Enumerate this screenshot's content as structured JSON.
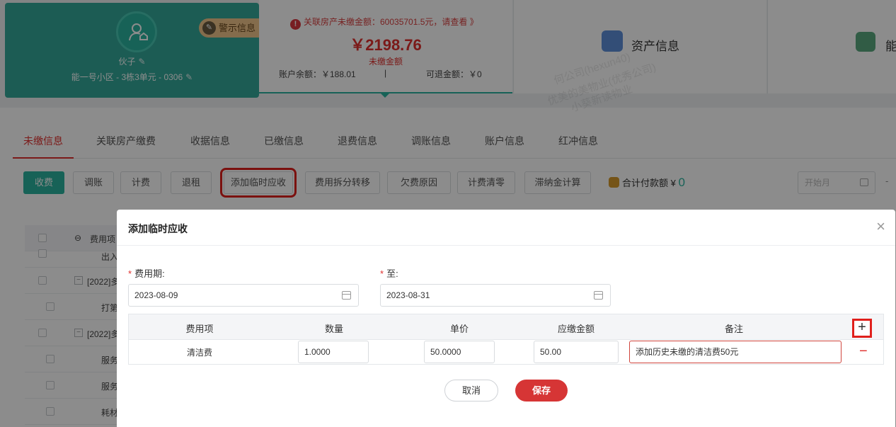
{
  "owner": {
    "name": "伙子",
    "house": "能一号小区 - 3栋3单元 - 0306",
    "warning_label": "警示信息"
  },
  "arrears": {
    "alert": "关联房产未缴金额：60035701.5元，请查看 》",
    "amount": "￥2198.76",
    "amount_label": "未缴金额",
    "balance": "账户余额：￥188.01",
    "separator": "|",
    "refundable": "可退金额：￥0"
  },
  "panels": {
    "asset_label": "资产信息",
    "energy_label": "能"
  },
  "watermarks": [
    "何公司(hexun40)",
    "优美的美物业(优秀公司)",
    "小葵新读物业"
  ],
  "tabs": [
    {
      "label": "未缴信息"
    },
    {
      "label": "关联房产缴费"
    },
    {
      "label": "收据信息"
    },
    {
      "label": "已缴信息"
    },
    {
      "label": "退费信息"
    },
    {
      "label": "调账信息"
    },
    {
      "label": "账户信息"
    },
    {
      "label": "红冲信息"
    }
  ],
  "toolbar": {
    "buttons": [
      "收费",
      "调账",
      "计费",
      "退租",
      "添加临时应收",
      "费用拆分转移",
      "欠费原因",
      "计费清零",
      "滞纳金计算"
    ],
    "total_label": "合计付款额",
    "total_currency": "¥",
    "total_value": "0",
    "start_month_placeholder": "开始月",
    "dash": "-"
  },
  "bg_table": {
    "header": "费用项",
    "rows": [
      "出入",
      "[2022]多",
      "打第",
      "[2022]多",
      "服务",
      "服务",
      "耗材"
    ]
  },
  "dialog": {
    "title": "添加临时应收",
    "close": "×",
    "period_label": "费用期:",
    "to_label": "至:",
    "start_date": "2023-08-09",
    "end_date": "2023-08-31",
    "columns": [
      "费用项",
      "数量",
      "单价",
      "应缴金额",
      "备注"
    ],
    "rows": [
      {
        "item": "清洁费",
        "quantity": "1.0000",
        "unit_price": "50.0000",
        "amount": "50.00",
        "note": "添加历史未缴的清洁费50元"
      }
    ],
    "add_row": "+",
    "remove_row": "−",
    "cancel": "取消",
    "save": "保存"
  }
}
